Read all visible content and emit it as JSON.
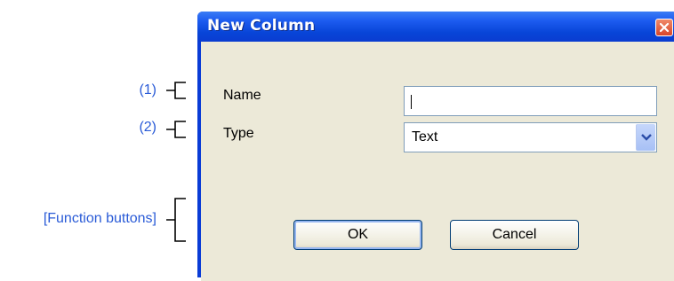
{
  "annotations": {
    "item1": "(1)",
    "item2": "(2)",
    "function_buttons": "[Function buttons]"
  },
  "dialog": {
    "title": "New Column",
    "name_label": "Name",
    "name_value": "",
    "type_label": "Type",
    "type_value": "Text",
    "ok_label": "OK",
    "cancel_label": "Cancel"
  },
  "colors": {
    "annotation": "#2a5bd7",
    "titlebar": "#0845d8",
    "client": "#ece9d8"
  },
  "icons": {
    "close": "close-icon",
    "dropdown": "chevron-down-icon"
  }
}
